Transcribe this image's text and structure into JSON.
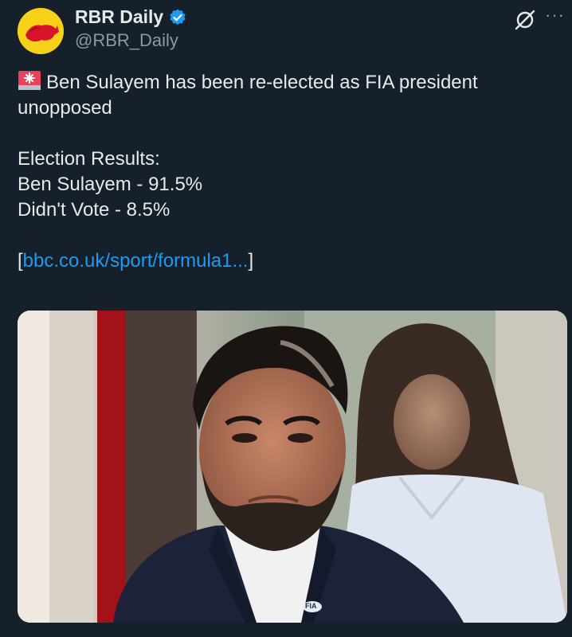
{
  "author": {
    "display_name": "RBR Daily",
    "handle": "@RBR_Daily",
    "verified": true,
    "avatar_icon": "red-bull-logo-icon",
    "accent": "#1d9bf0"
  },
  "actions": {
    "grok_icon": "grok-icon",
    "more_label": "···"
  },
  "tweet": {
    "headline_line1": "Ben Sulayem has been re-elected as FIA president",
    "headline_line2": "unopposed",
    "results_title": "Election Results:",
    "result_1": "Ben Sulayem - 91.5%",
    "result_2": "Didn't Vote - 8.5%",
    "link_open": "[",
    "link_text": "bbc.co.uk/sport/formula1...",
    "link_close": "]"
  },
  "media": {
    "badge_text": "FIA"
  }
}
